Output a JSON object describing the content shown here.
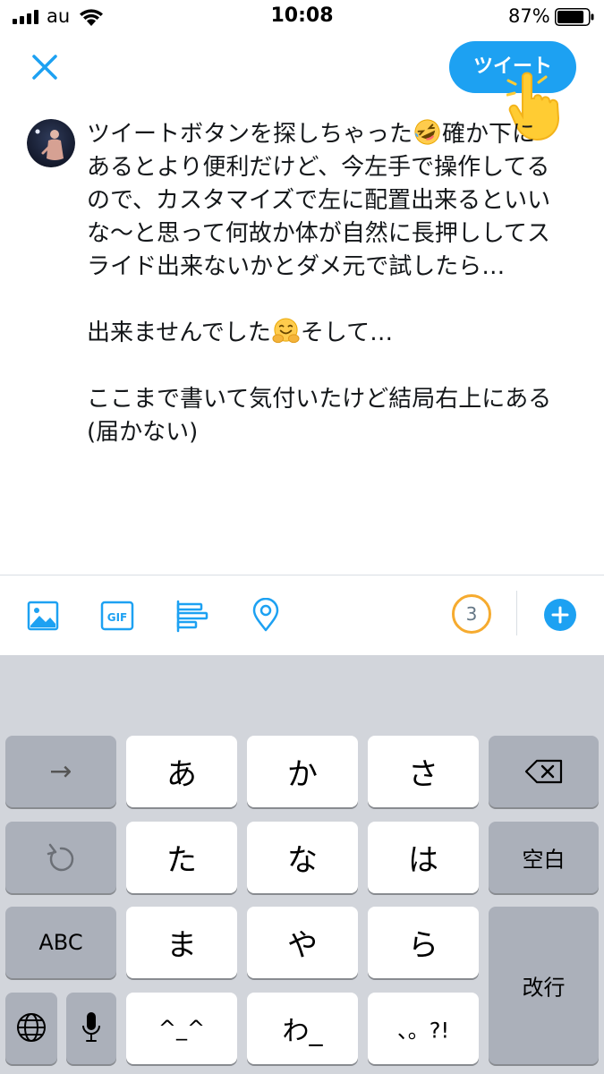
{
  "status_bar": {
    "carrier": "au",
    "time": "10:08",
    "battery_percent": "87%",
    "battery_level": 0.87
  },
  "compose": {
    "close_icon": "close-icon",
    "tweet_button_label": "ツイート",
    "tweet_lines": [
      "ツイートボタンを探しちゃった",
      "確か下に",
      "あるとより便利だけど、今左手で操作してる",
      "ので、カスタマイズで左に配置出来るといい",
      "な〜と思って何故か体が自然に長押ししてス",
      "ライド出来ないかとダメ元で試したら…",
      "出来ませんでした",
      "そして…",
      "ここまで書いて気付いたけど結局右上にある",
      "(届かない)"
    ]
  },
  "toolbar": {
    "icons": [
      "image-icon",
      "gif-icon",
      "poll-icon",
      "location-icon",
      "add-icon"
    ],
    "gif_label": "GIF",
    "remaining_count": "3"
  },
  "keyboard": {
    "arrow_key": "→",
    "row1": [
      "あ",
      "か",
      "さ"
    ],
    "row2": [
      "た",
      "な",
      "は"
    ],
    "row3": [
      "ま",
      "や",
      "ら"
    ],
    "row4": [
      "^_^",
      "わ_",
      "、。?!"
    ],
    "abc_label": "ABC",
    "space_label": "空白",
    "return_label": "改行"
  },
  "colors": {
    "accent": "#1da1f2",
    "counter_ring": "#f6ab2f",
    "keyboard_bg": "#d2d5db"
  }
}
